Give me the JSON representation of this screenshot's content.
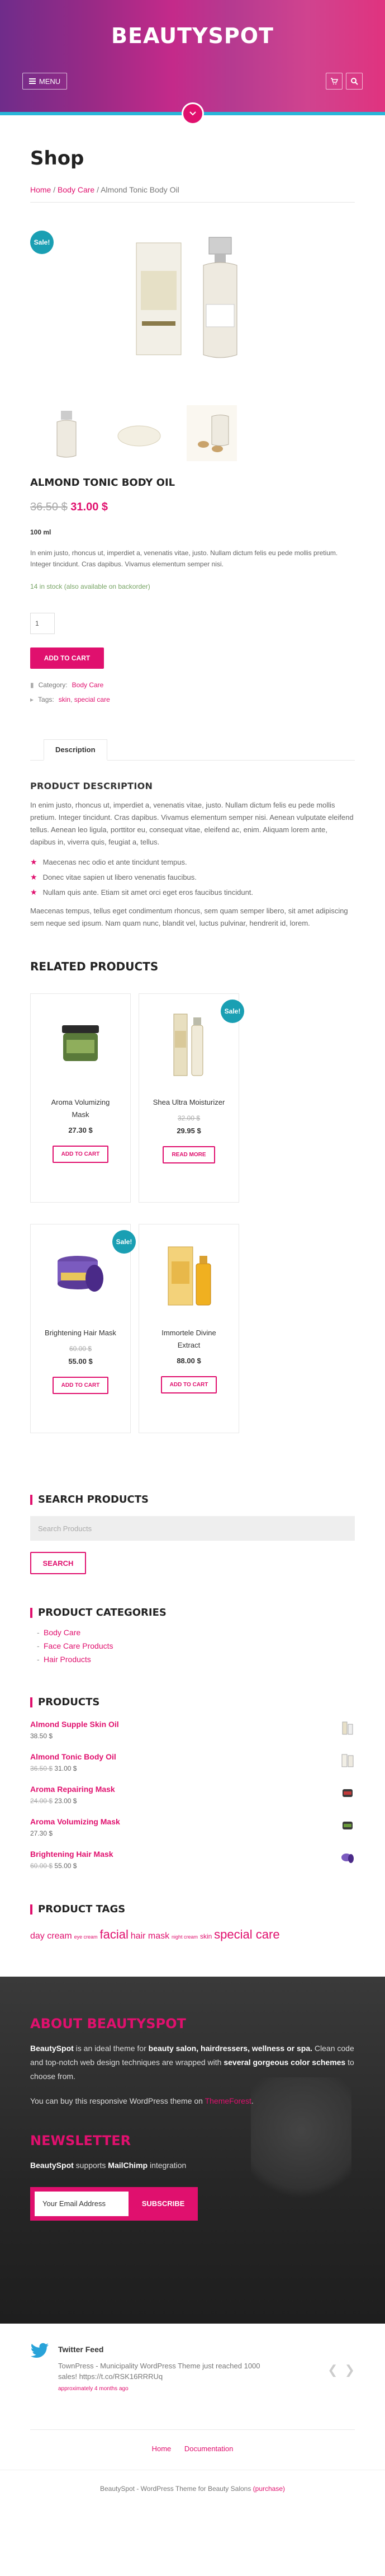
{
  "header": {
    "logo": "BEAUTYSPOT",
    "menu_label": "MENU",
    "cart_icon": "cart-icon",
    "search_icon": "search-icon",
    "scroll_icon": "chevron-down-icon"
  },
  "page": {
    "title": "Shop",
    "breadcrumb": {
      "home": "Home",
      "cat": "Body Care",
      "current": "Almond Tonic Body Oil"
    }
  },
  "product": {
    "sale_badge": "Sale!",
    "name": "ALMOND TONIC BODY OIL",
    "old_price": "36.50 $",
    "price": "31.00 $",
    "volume": "100 ml",
    "short_desc": "In enim justo, rhoncus ut, imperdiet a, venenatis vitae, justo. Nullam dictum felis eu pede mollis pretium. Integer tincidunt. Cras dapibus. Vivamus elementum semper nisi.",
    "stock": "14 in stock (also available on backorder)",
    "qty": "1",
    "add_to_cart": "ADD TO CART",
    "category_label": "Category:",
    "category": "Body Care",
    "tags_label": "Tags:",
    "tag1": "skin",
    "tag_sep": ", ",
    "tag2": "special care"
  },
  "tabs": {
    "description": "Description"
  },
  "description": {
    "heading": "PRODUCT DESCRIPTION",
    "p1": "In enim justo, rhoncus ut, imperdiet a, venenatis vitae, justo. Nullam dictum felis eu pede mollis pretium. Integer tincidunt. Cras dapibus. Vivamus elementum semper nisi. Aenean vulputate eleifend tellus. Aenean leo ligula, porttitor eu, consequat vitae, eleifend ac, enim. Aliquam lorem ante, dapibus in, viverra quis, feugiat a, tellus.",
    "bullets": [
      "Maecenas nec odio et ante tincidunt tempus.",
      "Donec vitae sapien ut libero venenatis faucibus.",
      "Nullam quis ante. Etiam sit amet orci eget eros faucibus tincidunt."
    ],
    "p2": "Maecenas tempus, tellus eget condimentum rhoncus, sem quam semper libero, sit amet adipiscing sem neque sed ipsum. Nam quam nunc, blandit vel, luctus pulvinar, hendrerit id, lorem."
  },
  "related": {
    "heading": "RELATED PRODUCTS",
    "items": [
      {
        "name": "Aroma Volumizing Mask",
        "old": "",
        "price": "27.30 $",
        "button": "ADD TO CART",
        "sale": ""
      },
      {
        "name": "Shea Ultra Moisturizer",
        "old": "32.00 $",
        "price": "29.95 $",
        "button": "READ MORE",
        "sale": "Sale!"
      },
      {
        "name": "Brightening Hair Mask",
        "old": "60.00 $",
        "price": "55.00 $",
        "button": "ADD TO CART",
        "sale": "Sale!"
      },
      {
        "name": "Immortele Divine Extract",
        "old": "",
        "price": "88.00 $",
        "button": "ADD TO CART",
        "sale": ""
      }
    ]
  },
  "widgets": {
    "search_title": "SEARCH PRODUCTS",
    "search_placeholder": "Search Products",
    "search_button": "SEARCH",
    "cat_title": "PRODUCT CATEGORIES",
    "categories": [
      "Body Care",
      "Face Care Products",
      "Hair Products"
    ],
    "products_title": "PRODUCTS",
    "products": [
      {
        "name": "Almond Supple Skin Oil",
        "old": "",
        "price": "38.50 $"
      },
      {
        "name": "Almond Tonic Body Oil",
        "old": "36.50 $",
        "price": "31.00 $"
      },
      {
        "name": "Aroma Repairing Mask",
        "old": "24.00 $",
        "price": "23.00 $"
      },
      {
        "name": "Aroma Volumizing Mask",
        "old": "",
        "price": "27.30 $"
      },
      {
        "name": "Brightening Hair Mask",
        "old": "60.00 $",
        "price": "55.00 $"
      }
    ],
    "tags_title": "PRODUCT TAGS",
    "tags": [
      {
        "t": "day cream",
        "s": 16
      },
      {
        "t": "eye cream",
        "s": 9
      },
      {
        "t": "facial",
        "s": 22
      },
      {
        "t": "hair mask",
        "s": 16
      },
      {
        "t": "night cream",
        "s": 9
      },
      {
        "t": "skin",
        "s": 12
      },
      {
        "t": "special care",
        "s": 22
      }
    ]
  },
  "footer": {
    "about_title": "ABOUT BEAUTYSPOT",
    "about_brand": "BeautySpot",
    "about_t1": " is an ideal theme for ",
    "about_b1": "beauty salon, hairdressers, wellness or spa.",
    "about_t2": " Clean code and top-notch web design techniques are wrapped with ",
    "about_b2": "several gorgeous color schemes",
    "about_t3": " to choose from.",
    "buy_text": "You can buy this responsive WordPress theme on ",
    "buy_link": "ThemeForest",
    "buy_end": ".",
    "newsletter_title": "NEWSLETTER",
    "nl_brand": "BeautySpot",
    "nl_t1": " supports ",
    "nl_b1": "MailChimp",
    "nl_t2": " integration",
    "nl_placeholder": "Your Email Address",
    "nl_button": "SUBSCRIBE"
  },
  "twitter": {
    "title": "Twitter Feed",
    "text": "TownPress - Municipality WordPress Theme just reached 1000 sales! https://t.co/RSK16RRRUq",
    "time": "approximately 4 months ago"
  },
  "bottom": {
    "nav": [
      "Home",
      "Documentation"
    ],
    "copyright": "BeautySpot - WordPress Theme for Beauty Salons",
    "purchase": "(purchase)"
  },
  "colors": {
    "accent": "#e0106e",
    "sale": "#1a9fb3"
  }
}
